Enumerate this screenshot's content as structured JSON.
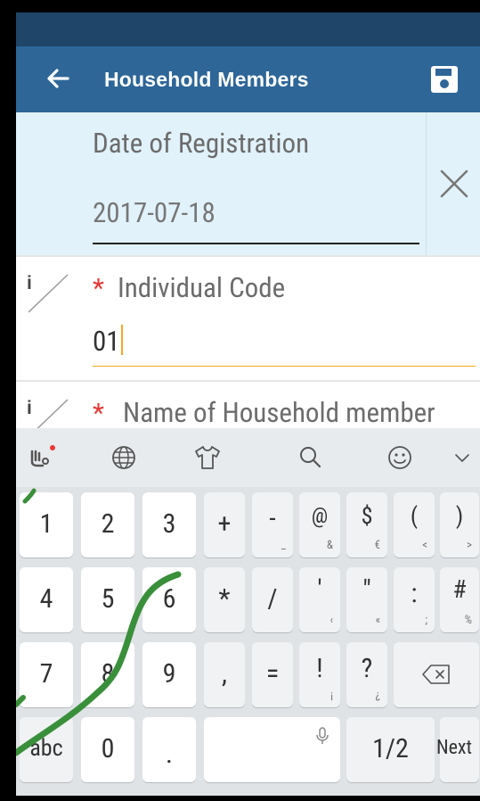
{
  "appbar": {
    "title": "Household Members"
  },
  "fields": [
    {
      "label": "Date of Registration",
      "value": "2017-07-18"
    },
    {
      "label": "Individual Code",
      "value": "01",
      "info": "i",
      "required": "*"
    },
    {
      "label": "Name of Household member",
      "info": "i",
      "required": "*"
    }
  ],
  "keyboard": {
    "toolbar": [
      "touchpal-icon",
      "globe-icon",
      "shirt-icon",
      "search-icon",
      "emoji-icon",
      "chevron-down-icon"
    ],
    "rows": [
      [
        {
          "m": "1"
        },
        {
          "m": "2"
        },
        {
          "m": "3"
        },
        {
          "m": "+"
        },
        {
          "m": "-",
          "s": "_"
        },
        {
          "m": "@",
          "s": "&"
        },
        {
          "m": "$",
          "s": "€"
        },
        {
          "m": "(",
          "s": "<"
        },
        {
          "m": ")",
          "s": ">"
        }
      ],
      [
        {
          "m": "4"
        },
        {
          "m": "5"
        },
        {
          "m": "6"
        },
        {
          "m": "*"
        },
        {
          "m": "/"
        },
        {
          "m": "'",
          "s": "‹"
        },
        {
          "m": "\"",
          "s": "«"
        },
        {
          "m": ":",
          "s": ";"
        },
        {
          "m": "#",
          "s": "%"
        }
      ],
      [
        {
          "m": "7"
        },
        {
          "m": "8"
        },
        {
          "m": "9"
        },
        {
          "m": ","
        },
        {
          "m": "="
        },
        {
          "m": "!",
          "s": "¡"
        },
        {
          "m": "?",
          "s": "¿"
        }
      ],
      [
        {
          "m": "abc"
        },
        {
          "m": "0"
        },
        {
          "m": "."
        },
        {
          "m": "1/2"
        },
        {
          "m": "Next"
        }
      ]
    ]
  },
  "colors": {
    "statusbar": "#1f4668",
    "appbar": "#2e6698",
    "highlight": "#e1f2fa",
    "required": "#e53935",
    "cursor": "#f5a623",
    "scribble": "#3a8f3a"
  }
}
